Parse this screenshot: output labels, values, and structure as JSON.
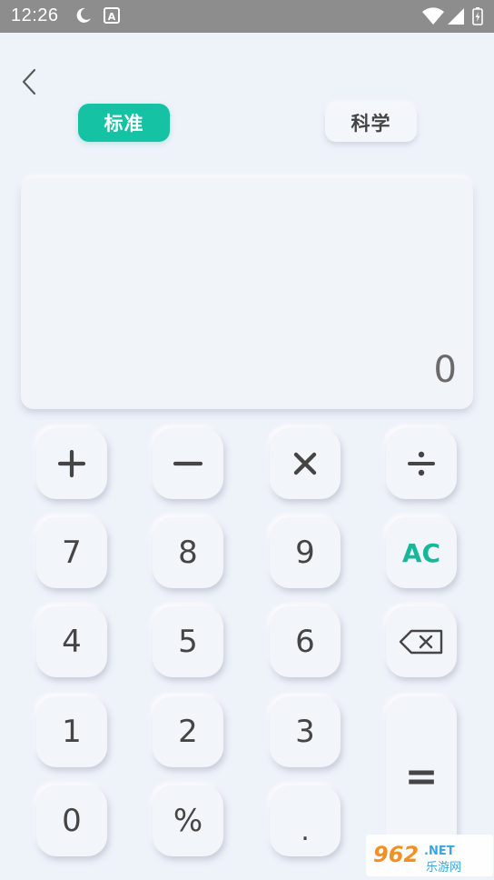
{
  "status_bar": {
    "time": "12:26",
    "left_icons": [
      "moon-icon",
      "a-notification-icon"
    ],
    "right_icons": [
      "wifi-icon",
      "signal-icon",
      "battery-charging-icon"
    ]
  },
  "nav": {
    "back_icon": "chevron-left-icon"
  },
  "tabs": [
    {
      "label": "标准",
      "active": true
    },
    {
      "label": "科学",
      "active": false
    }
  ],
  "display": {
    "value": "0"
  },
  "keypad": {
    "plus": "+",
    "minus": "−",
    "times": "×",
    "divide": "÷",
    "seven": "7",
    "eight": "8",
    "nine": "9",
    "clear": "AC",
    "four": "4",
    "five": "5",
    "six": "6",
    "backspace_icon": "backspace-icon",
    "one": "1",
    "two": "2",
    "three": "3",
    "equals": "=",
    "zero": "0",
    "percent": "%",
    "dot": "."
  },
  "colors": {
    "accent": "#16c2a4",
    "background": "#eef2f9",
    "statusbar": "#8d8d8d"
  }
}
